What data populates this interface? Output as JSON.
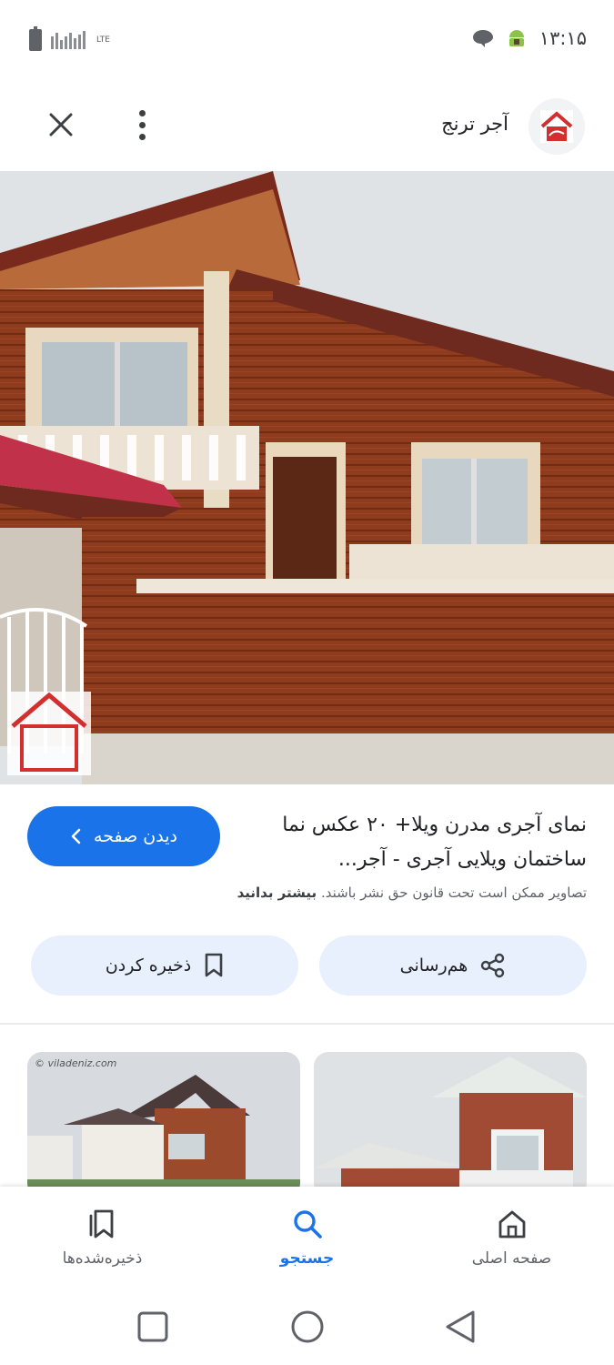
{
  "status_bar": {
    "time": "۱۳:۱۵",
    "network": "LTE"
  },
  "header": {
    "site_name": "آجر ترنج",
    "logo_text": "آجر ترنج"
  },
  "result": {
    "title": "نمای آجری مدرن ویلا+ ۲۰ عکس نما ساختمان ویلایی آجری - آجر...",
    "visit_button": "دیدن صفحه",
    "copyright_text": "تصاویر ممکن است تحت قانون حق نشر باشند.",
    "learn_more": "بیشتر بدانید"
  },
  "actions": {
    "share": "هم‌رسانی",
    "save": "ذخیره کردن"
  },
  "related": {
    "left_watermark": "© viladeniz.com"
  },
  "bottom_nav": {
    "home": "صفحه اصلی",
    "search": "جستجو",
    "saved": "ذخیره‌شده‌ها"
  },
  "colors": {
    "accent": "#1a73e8",
    "chip_bg": "#e8f0fe",
    "brick": "#8e3b1e"
  }
}
